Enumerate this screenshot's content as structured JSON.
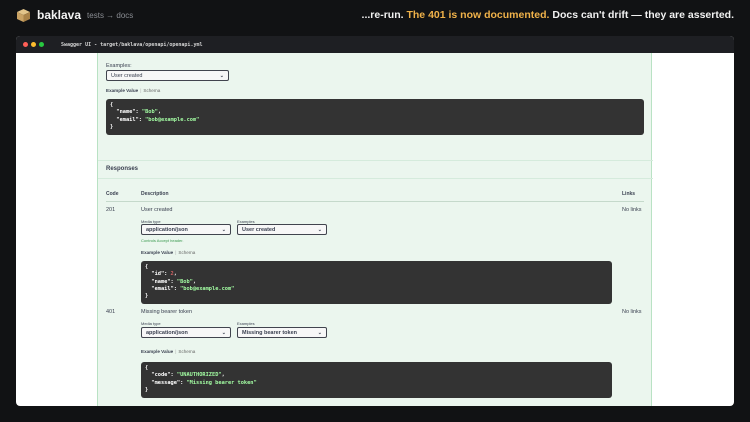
{
  "header": {
    "brand": "baklava",
    "crumb": "tests → docs",
    "tagline_pre": "...re-run. ",
    "tagline_hl": "The 401 is now documented.",
    "tagline_post": " Docs can't drift — they are asserted."
  },
  "window": {
    "title": "Swagger UI - target/baklava/openapi/openapi.yml",
    "dots": [
      "#ff5f57",
      "#febc2e",
      "#28c840"
    ]
  },
  "request": {
    "examples_label": "Examples:",
    "examples_selected": "User created",
    "tab_active": "Example Value",
    "tab_other": "Schema",
    "body": {
      "l1": "{",
      "name_key": "\"name\"",
      "name_val": "\"Bob\"",
      "email_key": "\"email\"",
      "email_val": "\"bob@example.com\"",
      "l4": "}"
    }
  },
  "responses": {
    "title": "Responses",
    "col_code": "Code",
    "col_desc": "Description",
    "col_links": "Links",
    "items": [
      {
        "code": "201",
        "description": "User created",
        "links": "No links",
        "media_type_label": "Media type",
        "media_type": "application/json",
        "controls_note": "Controls Accept header.",
        "examples_label": "Examples",
        "example_selected": "User created",
        "tab_active": "Example Value",
        "tab_other": "Schema",
        "body": {
          "open": "{",
          "id_key": "\"id\"",
          "id_val": "2",
          "name_key": "\"name\"",
          "name_val": "\"Bob\"",
          "email_key": "\"email\"",
          "email_val": "\"bob@example.com\"",
          "close": "}"
        }
      },
      {
        "code": "401",
        "description": "Missing bearer token",
        "links": "No links",
        "media_type_label": "Media type",
        "media_type": "application/json",
        "examples_label": "Examples",
        "example_selected": "Missing bearer token",
        "tab_active": "Example Value",
        "tab_other": "Schema",
        "body": {
          "open": "{",
          "code_key": "\"code\"",
          "code_val": "\"UNAUTHORIZED\"",
          "message_key": "\"message\"",
          "message_val": "\"Missing bearer token\"",
          "close": "}"
        }
      }
    ]
  }
}
